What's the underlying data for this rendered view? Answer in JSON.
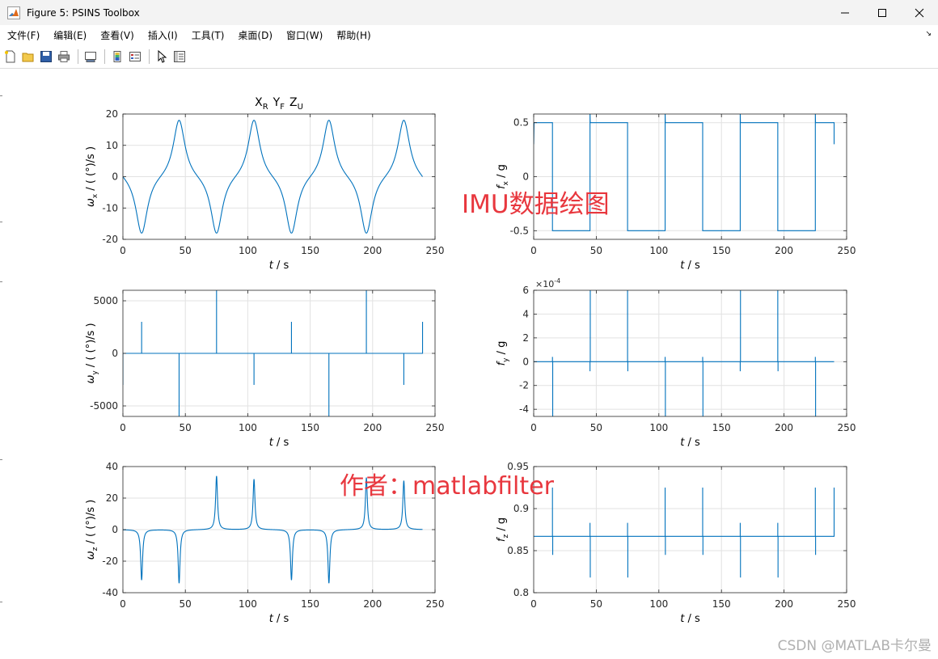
{
  "window": {
    "title": "Figure 5: PSINS Toolbox",
    "icon": "matlab-logo-icon",
    "controls": [
      "minimize-icon",
      "maximize-icon",
      "close-icon"
    ]
  },
  "menu": {
    "items": [
      "文件(F)",
      "编辑(E)",
      "查看(V)",
      "插入(I)",
      "工具(T)",
      "桌面(D)",
      "窗口(W)",
      "帮助(H)"
    ],
    "overflow_icon": "chevron-icon"
  },
  "toolbar": {
    "icons": [
      "new-figure-icon",
      "open-icon",
      "save-icon",
      "print-icon",
      "link-icon",
      "colorbar-icon",
      "legend-icon",
      "pointer-icon",
      "property-inspector-icon"
    ]
  },
  "colors": {
    "line": "#0072bd",
    "grid": "#e2e2e2",
    "axis": "#262626",
    "watermark": "#e8373e"
  },
  "watermarks": {
    "imu": "IMU数据绘图",
    "author": "作者：matlabfilter",
    "csdn": "CSDN @MATLAB卡尔曼"
  },
  "chart_data": [
    {
      "id": "wx",
      "type": "line",
      "title_parts": [
        [
          "X",
          "R"
        ],
        [
          "Y",
          "F"
        ],
        [
          "Z",
          "U"
        ]
      ],
      "ylabel_sym": "ω",
      "ylabel_sub": "x",
      "ylabel_unit": " / ( (°)/s )",
      "xlabel": "t  / s",
      "xlim": [
        0,
        250
      ],
      "ylim": [
        -20,
        20
      ],
      "xticks": [
        0,
        50,
        100,
        150,
        200,
        250
      ],
      "yticks": [
        -20,
        -10,
        0,
        10,
        20
      ],
      "signal": "omega_x",
      "xmax": 240,
      "grid": true
    },
    {
      "id": "fx",
      "type": "line",
      "ylabel_sym": "f",
      "ylabel_sub": "x",
      "ylabel_unit": " / g",
      "xlabel": "t  / s",
      "xlim": [
        0,
        250
      ],
      "ylim": [
        -0.58,
        0.58
      ],
      "xticks": [
        0,
        50,
        100,
        150,
        200,
        250
      ],
      "yticks": [
        -0.5,
        0,
        0.5
      ],
      "signal": "f_x",
      "xmax": 240,
      "grid": true
    },
    {
      "id": "wy",
      "type": "line",
      "ylabel_sym": "ω",
      "ylabel_sub": "y",
      "ylabel_unit": " / ( (°)/s )",
      "xlabel": "t  / s",
      "xlim": [
        0,
        250
      ],
      "ylim": [
        -6000,
        6000
      ],
      "xticks": [
        0,
        50,
        100,
        150,
        200,
        250
      ],
      "yticks": [
        -5000,
        0,
        5000
      ],
      "signal": "omega_y",
      "xmax": 240,
      "grid": true
    },
    {
      "id": "fy",
      "type": "line",
      "ylabel_sym": "f",
      "ylabel_sub": "y",
      "ylabel_unit": " / g",
      "xlabel": "t  / s",
      "exponent_label": "×10",
      "exponent_power": "-4",
      "xlim": [
        0,
        250
      ],
      "ylim": [
        -4.6,
        6
      ],
      "xticks": [
        0,
        50,
        100,
        150,
        200,
        250
      ],
      "yticks": [
        -4,
        -2,
        0,
        2,
        4,
        6
      ],
      "signal": "f_y",
      "xmax": 240,
      "grid": true
    },
    {
      "id": "wz",
      "type": "line",
      "ylabel_sym": "ω",
      "ylabel_sub": "z",
      "ylabel_unit": " / ( (°)/s )",
      "xlabel": "t  / s",
      "xlim": [
        0,
        250
      ],
      "ylim": [
        -40,
        40
      ],
      "xticks": [
        0,
        50,
        100,
        150,
        200,
        250
      ],
      "yticks": [
        -40,
        -20,
        0,
        20,
        40
      ],
      "signal": "omega_z",
      "xmax": 240,
      "grid": true
    },
    {
      "id": "fz",
      "type": "line",
      "ylabel_sym": "f",
      "ylabel_sub": "z",
      "ylabel_unit": " / g",
      "xlabel": "t  / s",
      "xlim": [
        0,
        250
      ],
      "ylim": [
        0.8,
        0.95
      ],
      "xticks": [
        0,
        50,
        100,
        150,
        200,
        250
      ],
      "yticks": [
        0.8,
        0.85,
        0.9,
        0.95
      ],
      "signal": "f_z",
      "xmax": 240,
      "grid": true
    }
  ]
}
